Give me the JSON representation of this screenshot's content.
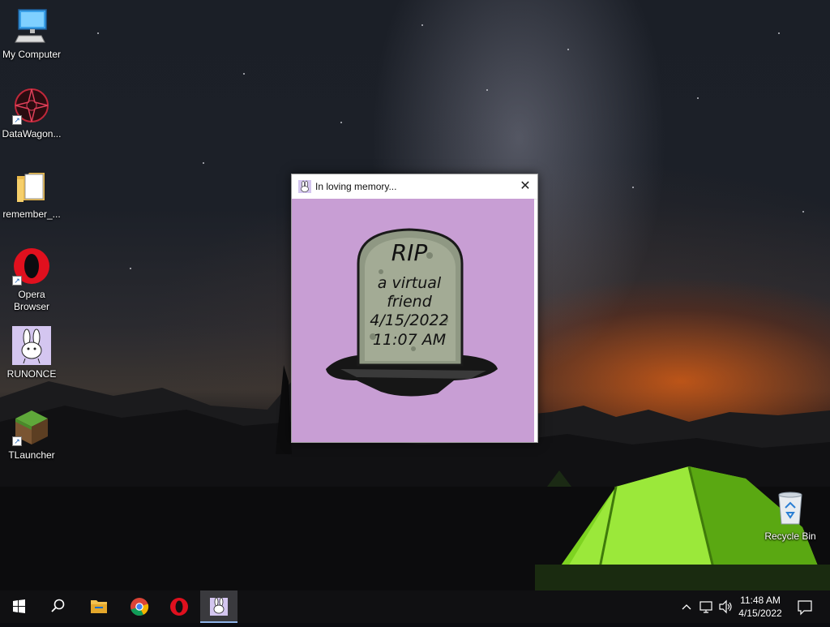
{
  "desktop": {
    "icons": [
      {
        "label": "My Computer"
      },
      {
        "label": "DataWagon..."
      },
      {
        "label": "remember_..."
      },
      {
        "label": "Opera Browser"
      },
      {
        "label": "RUNONCE"
      },
      {
        "label": "TLauncher"
      },
      {
        "label": "Recycle Bin"
      }
    ]
  },
  "window": {
    "title": "In loving memory...",
    "close_glyph": "✕",
    "background_color": "#c89ed4",
    "tombstone": {
      "line1": "RIP",
      "line2": "a virtual",
      "line3": "friend",
      "line4": "4/15/2022",
      "line5": "11:07 AM"
    }
  },
  "taskbar": {
    "items": [
      {
        "icon": "windows-start-icon"
      },
      {
        "icon": "search-icon"
      },
      {
        "icon": "file-explorer-icon"
      },
      {
        "icon": "chrome-icon"
      },
      {
        "icon": "opera-icon"
      },
      {
        "icon": "bunny-app-icon",
        "active": true
      }
    ],
    "tray_chevron": "^",
    "clock": {
      "time": "11:48 AM",
      "date": "4/15/2022"
    }
  }
}
